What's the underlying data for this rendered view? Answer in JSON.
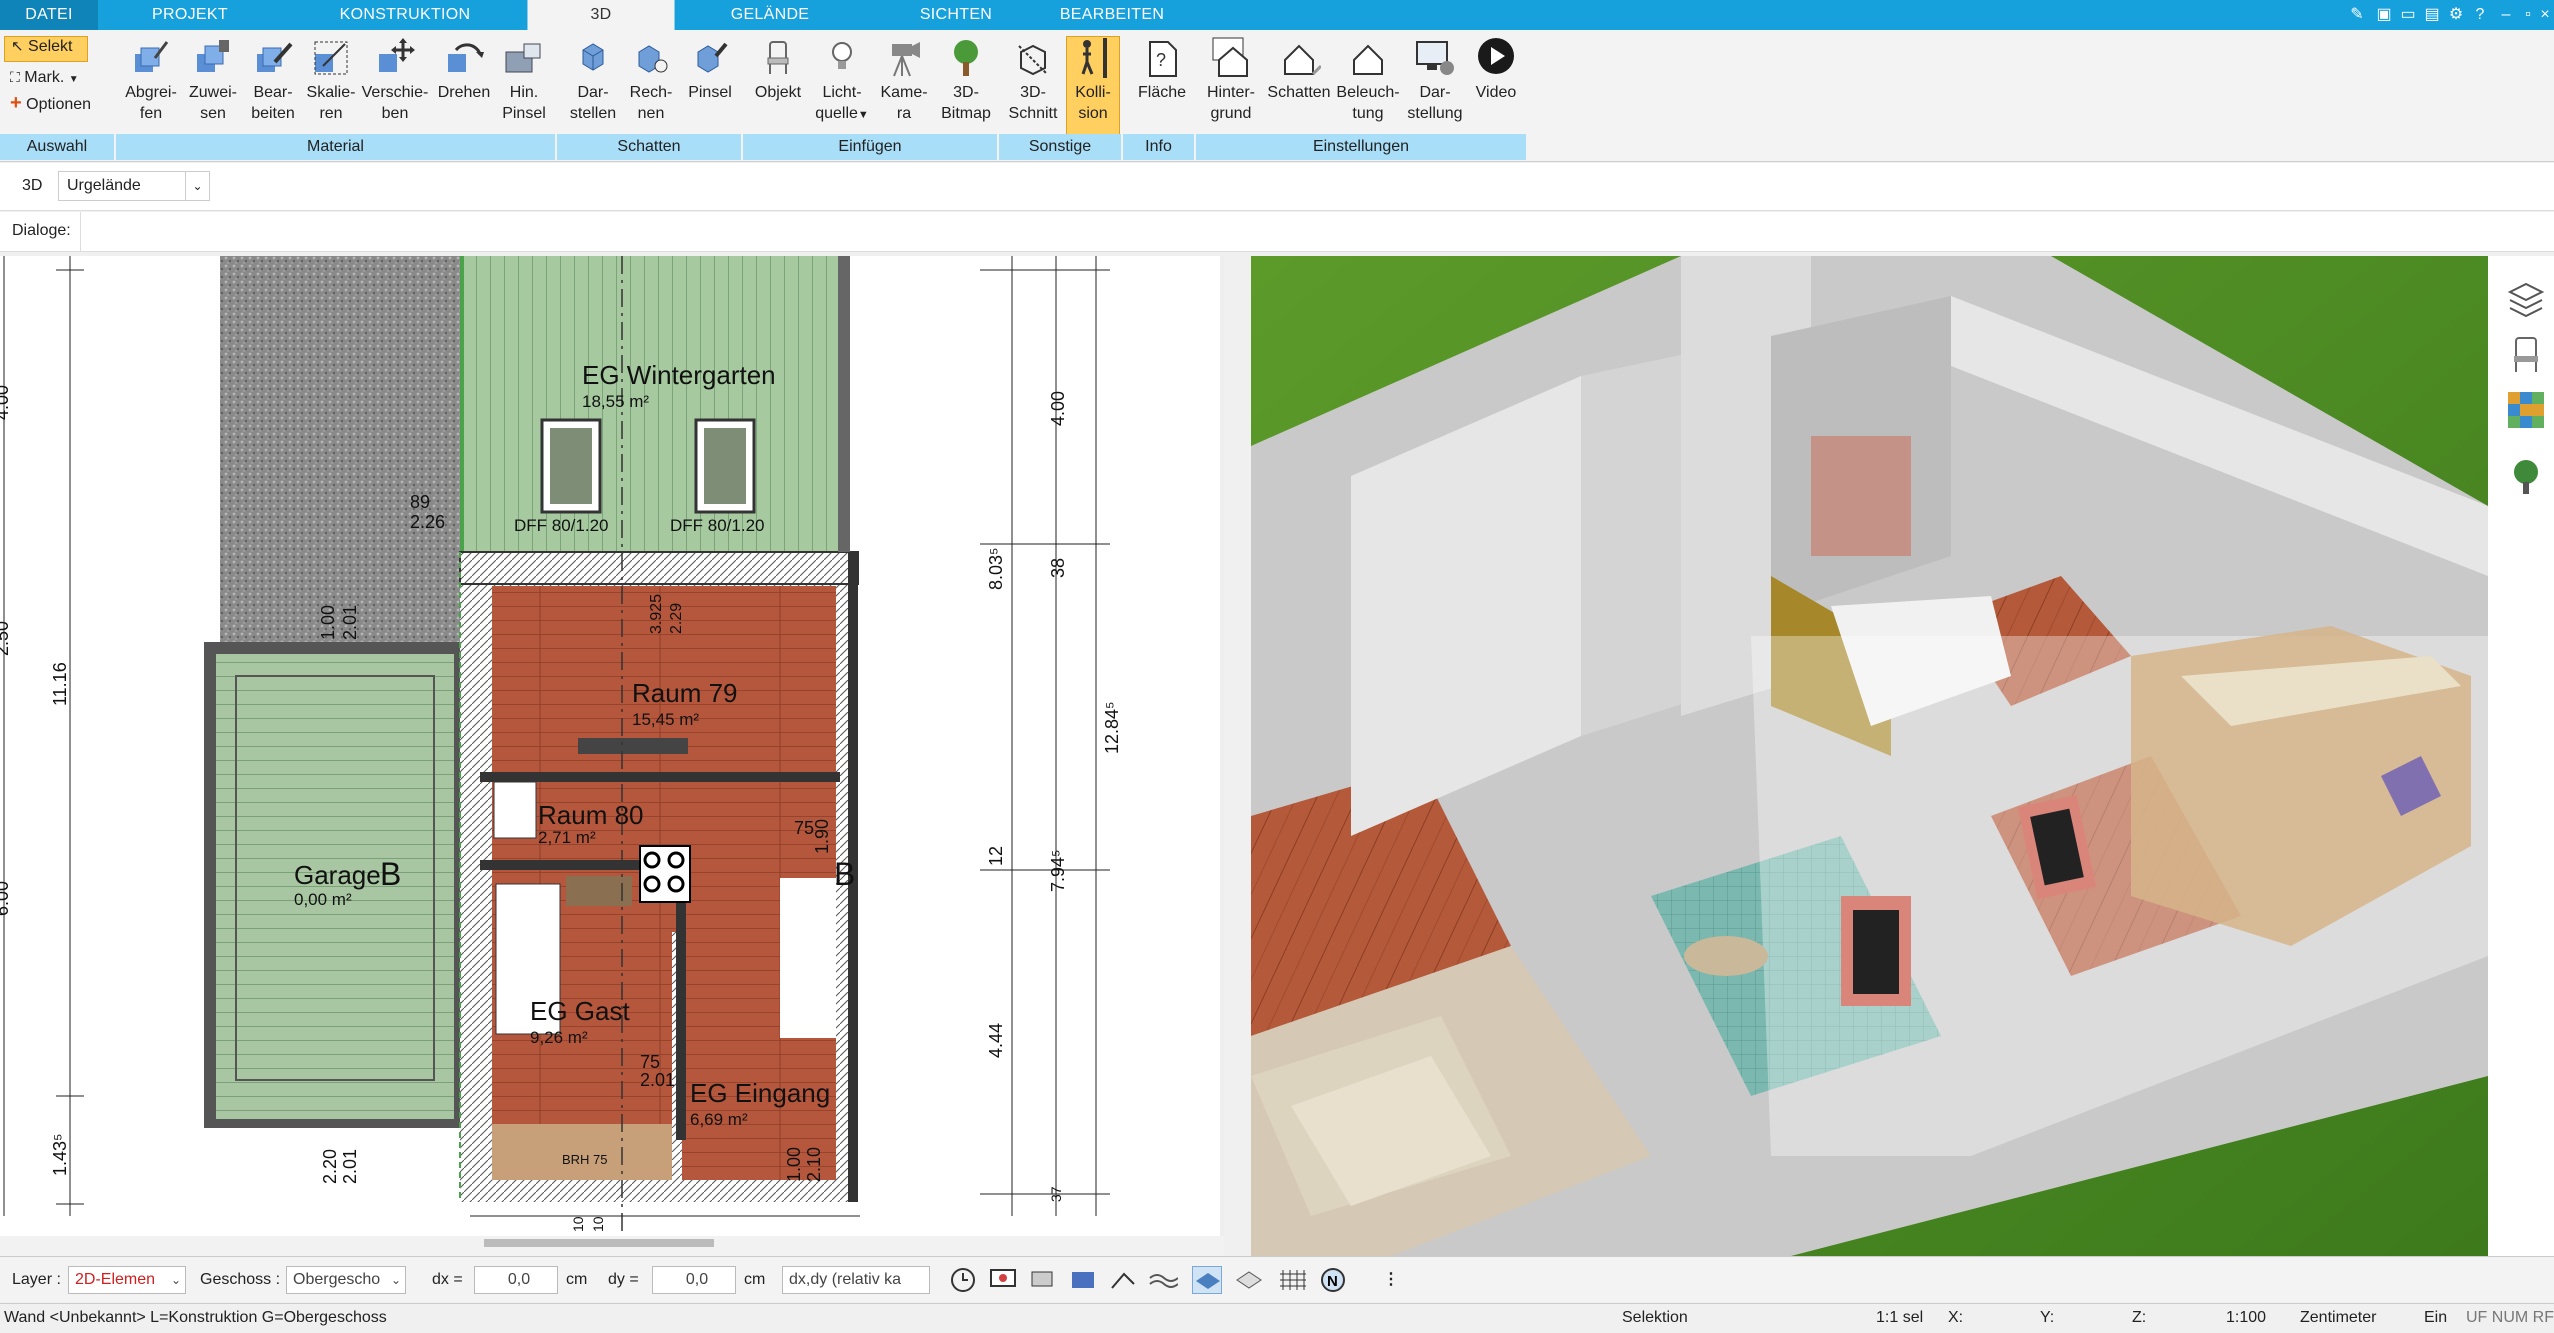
{
  "tabs": [
    {
      "label": "DATEI"
    },
    {
      "label": "PROJEKT"
    },
    {
      "label": "KONSTRUKTION"
    },
    {
      "label": "3D"
    },
    {
      "label": "GELÄNDE"
    },
    {
      "label": "SICHTEN"
    },
    {
      "label": "BEARBEITEN"
    }
  ],
  "ribbon": {
    "auswahl": {
      "select": "Selekt",
      "mark": "Mark.",
      "options": "Optionen",
      "group": "Auswahl"
    },
    "material": {
      "group": "Material",
      "buttons": [
        {
          "l1": "Abgrei-",
          "l2": "fen"
        },
        {
          "l1": "Zuwei-",
          "l2": "sen"
        },
        {
          "l1": "Bear-",
          "l2": "beiten"
        },
        {
          "l1": "Skalie-",
          "l2": "ren"
        },
        {
          "l1": "Verschie-",
          "l2": "ben"
        },
        {
          "l1": "Drehen",
          "l2": ""
        },
        {
          "l1": "Hin.",
          "l2": "Pinsel"
        }
      ]
    },
    "schatten": {
      "group": "Schatten",
      "buttons": [
        {
          "l1": "Dar-",
          "l2": "stellen"
        },
        {
          "l1": "Rech-",
          "l2": "nen"
        },
        {
          "l1": "Pinsel",
          "l2": ""
        }
      ]
    },
    "einfuegen": {
      "group": "Einfügen",
      "buttons": [
        {
          "l1": "Objekt",
          "l2": ""
        },
        {
          "l1": "Licht-",
          "l2": "quelle"
        },
        {
          "l1": "Kame-",
          "l2": "ra"
        },
        {
          "l1": "3D-",
          "l2": "Bitmap"
        }
      ]
    },
    "sonstige": {
      "group": "Sonstige",
      "buttons": [
        {
          "l1": "3D-",
          "l2": "Schnitt"
        },
        {
          "l1": "Kolli-",
          "l2": "sion"
        }
      ]
    },
    "info": {
      "group": "Info",
      "buttons": [
        {
          "l1": "Fläche",
          "l2": ""
        }
      ]
    },
    "einstellungen": {
      "group": "Einstellungen",
      "buttons": [
        {
          "l1": "Hinter-",
          "l2": "grund"
        },
        {
          "l1": "Schatten",
          "l2": ""
        },
        {
          "l1": "Beleuch-",
          "l2": "tung"
        },
        {
          "l1": "Dar-",
          "l2": "stellung"
        },
        {
          "l1": "Video",
          "l2": ""
        }
      ]
    }
  },
  "subbar": {
    "mode": "3D",
    "selected": "Urgelände"
  },
  "dialog": {
    "label": "Dialoge:"
  },
  "plan": {
    "rooms": [
      {
        "name": "EG Wintergarten",
        "area": "18,55 m²"
      },
      {
        "name": "Raum 79",
        "area": "15,45 m²"
      },
      {
        "name": "Raum 80",
        "area": "2,71 m²"
      },
      {
        "name": "Garage",
        "area": "0,00 m²"
      },
      {
        "name": "EG Gast",
        "area": "9,26 m²"
      },
      {
        "name": "EG Eingang",
        "area": "6,69 m²"
      }
    ],
    "windows": [
      "DFF 80/1.20",
      "DFF 80/1.20"
    ],
    "section_marks": [
      "B",
      "B"
    ],
    "labels": {
      "d_89": "89",
      "d_226": "2.26",
      "d_100": "1.00",
      "d_201": "2.01",
      "d_3925": "3.925",
      "d_229": "2.29",
      "d_75a": "75",
      "d_190": "1.90",
      "d_75b": "75",
      "d_201b": "2.01",
      "d_220": "2.20",
      "d_201c": "2.01",
      "d_100b": "1.00",
      "d_210": "2.10",
      "brh": "BRH 75",
      "l_1116": "11.16",
      "l_400": "4.00",
      "l_250": "2.50",
      "l_600": "6.00",
      "l_1435": "1.43⁵",
      "r_400": "4.00",
      "r_8035": "8.03⁵",
      "r_38": "38",
      "r_1285": "12.84⁵",
      "r_12": "12",
      "r_7945": "7.94⁵",
      "r_444": "4.44",
      "r_37": "37",
      "b_10": "10",
      "b_10b": "10"
    }
  },
  "bottom": {
    "layer_label": "Layer :",
    "layer_value": "2D-Elemen",
    "floor_label": "Geschoss :",
    "floor_value": "Obergescho",
    "dx_label": "dx =",
    "dx_value": "0,0",
    "dx_unit": "cm",
    "dy_label": "dy =",
    "dy_value": "0,0",
    "dy_unit": "cm",
    "mode_value": "dx,dy (relativ ka"
  },
  "status": {
    "hint": "Wand <Unbekannt> L=Konstruktion G=Obergeschoss",
    "mode": "Selektion",
    "sel": "1:1 sel",
    "x": "X:",
    "y": "Y:",
    "z": "Z:",
    "scale": "1:100",
    "unit": "Zentimeter",
    "ein": "Ein",
    "flags": "UF NUM RF"
  },
  "colors": {
    "accent": "#16a0dc",
    "group_bg": "#a8def7",
    "active_tool": "#ffcf60",
    "floor_wood": "#b5573c",
    "grass": "#4f8a27"
  }
}
